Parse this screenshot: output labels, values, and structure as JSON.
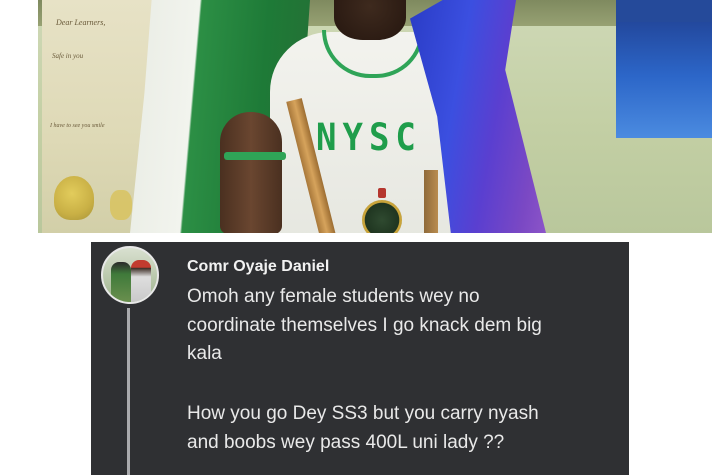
{
  "photo": {
    "board_lines": [
      "Dear Learners,",
      "Safe in you",
      "I have to see you smile"
    ],
    "shirt_text": "NYSC",
    "colors": {
      "green": "#1f9d4b",
      "flag_blue": "#3b4fe0",
      "flag_purple": "#7a48c4"
    }
  },
  "comment": {
    "author": "Comr Oyaje Daniel",
    "lines": [
      "Omoh any female students wey no",
      "coordinate themselves I go knack dem big",
      "kala",
      "How you go Dey SS3 but you carry nyash",
      "and boobs wey pass 400L uni lady ??"
    ],
    "colors": {
      "background": "#2f3033",
      "text": "#e9e9e9"
    }
  }
}
